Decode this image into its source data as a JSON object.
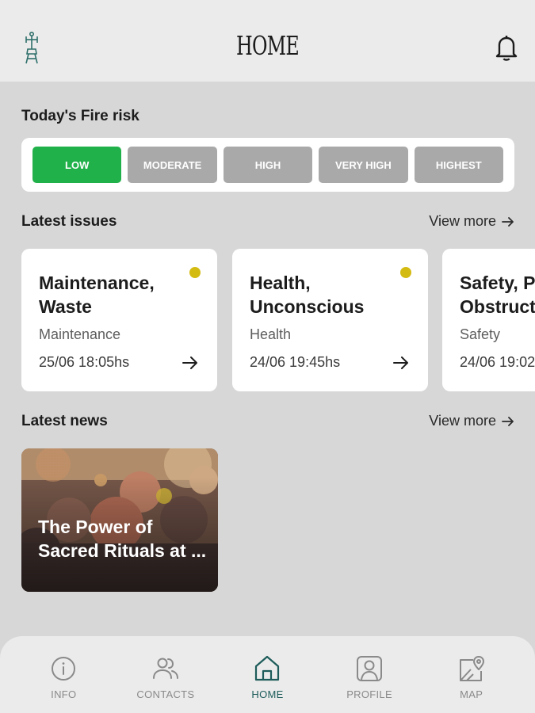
{
  "header": {
    "title": "HOME",
    "logo_icon": "stilt-figure-logo-icon",
    "bell_icon": "bell-icon"
  },
  "fire_risk": {
    "title": "Today's Fire risk",
    "active_color": "#21b14a",
    "inactive_color": "#a9a9a9",
    "levels": [
      {
        "label": "LOW",
        "active": true
      },
      {
        "label": "MODERATE",
        "active": false
      },
      {
        "label": "HIGH",
        "active": false
      },
      {
        "label": "VERY HIGH",
        "active": false
      },
      {
        "label": "HIGHEST",
        "active": false
      }
    ]
  },
  "issues": {
    "title": "Latest issues",
    "view_more": "View more",
    "status_dot_color": "#d4bb12",
    "items": [
      {
        "title_line1": "Maintenance,",
        "title_line2": "Waste",
        "category": "Maintenance",
        "date": "25/06 18:05hs"
      },
      {
        "title_line1": "Health,",
        "title_line2": "Unconscious",
        "category": "Health",
        "date": "24/06 19:45hs"
      },
      {
        "title_line1": "Safety, Pa",
        "title_line2": "Obstructi",
        "category": "Safety",
        "date": "24/06 19:02"
      }
    ]
  },
  "news": {
    "title": "Latest news",
    "view_more": "View more",
    "items": [
      {
        "title": "The Power of Sacred Rituals at ..."
      }
    ]
  },
  "bottom_nav": {
    "active_color": "#1d5c5a",
    "items": [
      {
        "label": "INFO",
        "icon": "info-icon"
      },
      {
        "label": "CONTACTS",
        "icon": "contacts-icon"
      },
      {
        "label": "HOME",
        "icon": "home-icon",
        "active": true
      },
      {
        "label": "PROFILE",
        "icon": "profile-icon"
      },
      {
        "label": "MAP",
        "icon": "map-pin-icon"
      }
    ]
  }
}
